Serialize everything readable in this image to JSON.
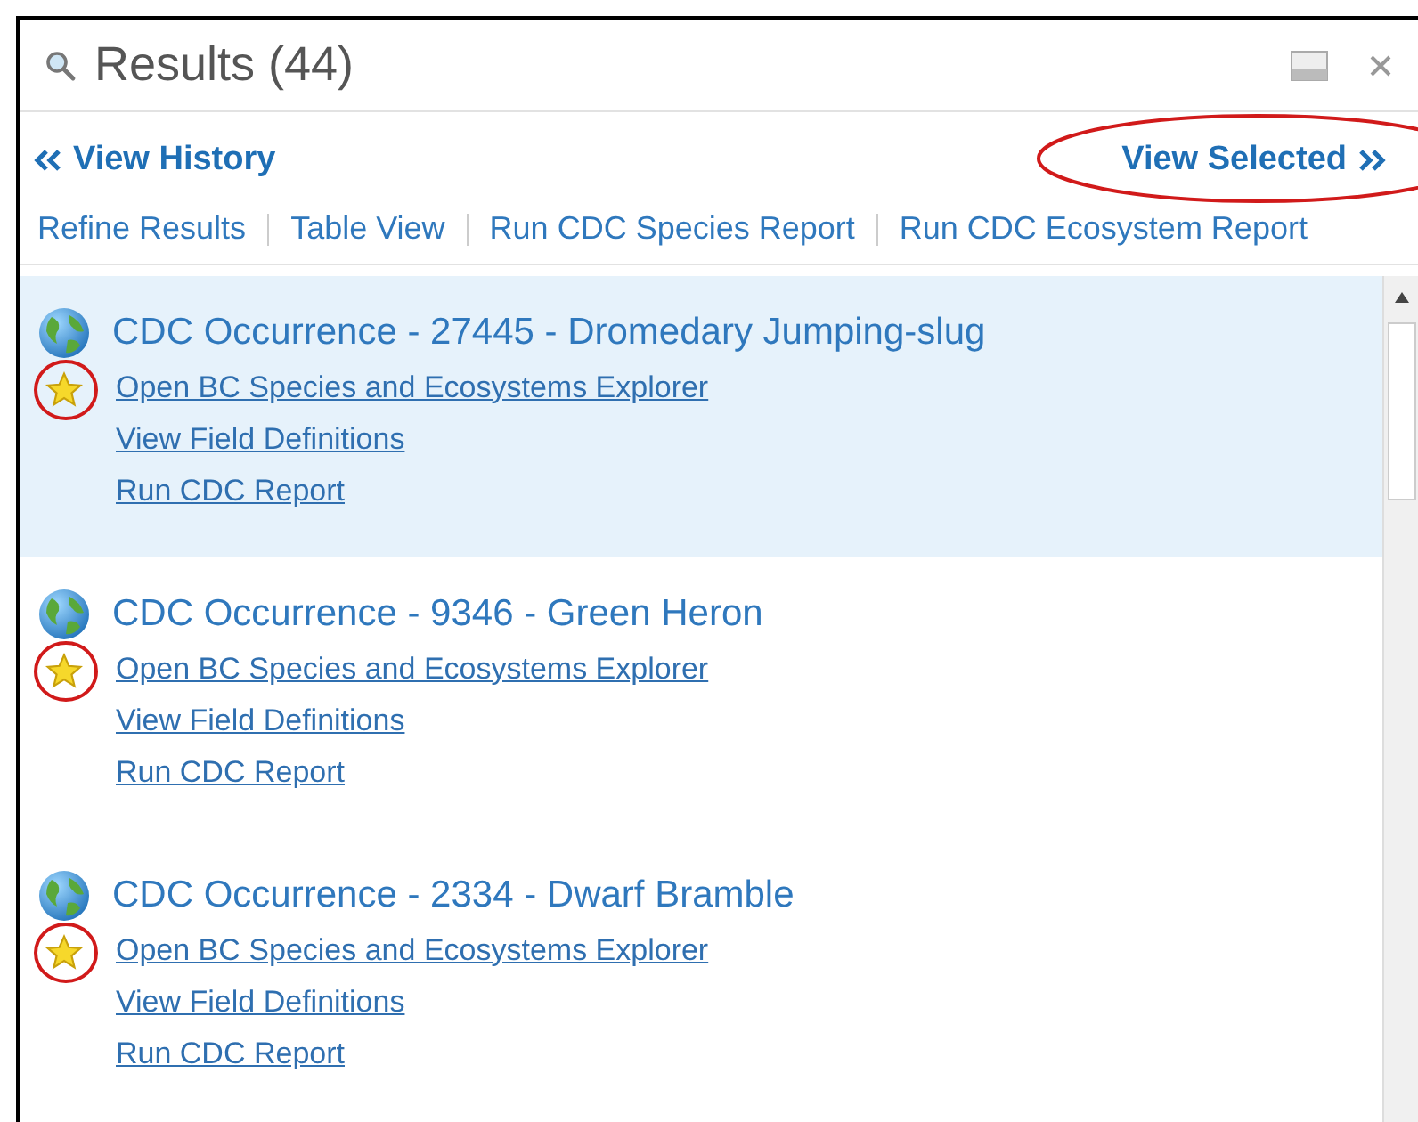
{
  "window": {
    "title": "Results (44)"
  },
  "nav": {
    "back": {
      "label": "View History"
    },
    "forward": {
      "label": "View Selected",
      "annotated": true
    }
  },
  "actions": [
    "Refine Results",
    "Table View",
    "Run CDC Species Report",
    "Run CDC Ecosystem Report"
  ],
  "results": [
    {
      "title": "CDC Occurrence - 27445 - Dromedary Jumping-slug",
      "selected": true,
      "annotated": true,
      "links": [
        "Open BC Species and Ecosystems Explorer",
        "View Field Definitions",
        "Run CDC Report"
      ]
    },
    {
      "title": "CDC Occurrence - 9346 - Green Heron",
      "selected": false,
      "annotated": true,
      "links": [
        "Open BC Species and Ecosystems Explorer",
        "View Field Definitions",
        "Run CDC Report"
      ]
    },
    {
      "title": "CDC Occurrence - 2334 - Dwarf Bramble",
      "selected": false,
      "annotated": true,
      "links": [
        "Open BC Species and Ecosystems Explorer",
        "View Field Definitions",
        "Run CDC Report"
      ]
    }
  ]
}
